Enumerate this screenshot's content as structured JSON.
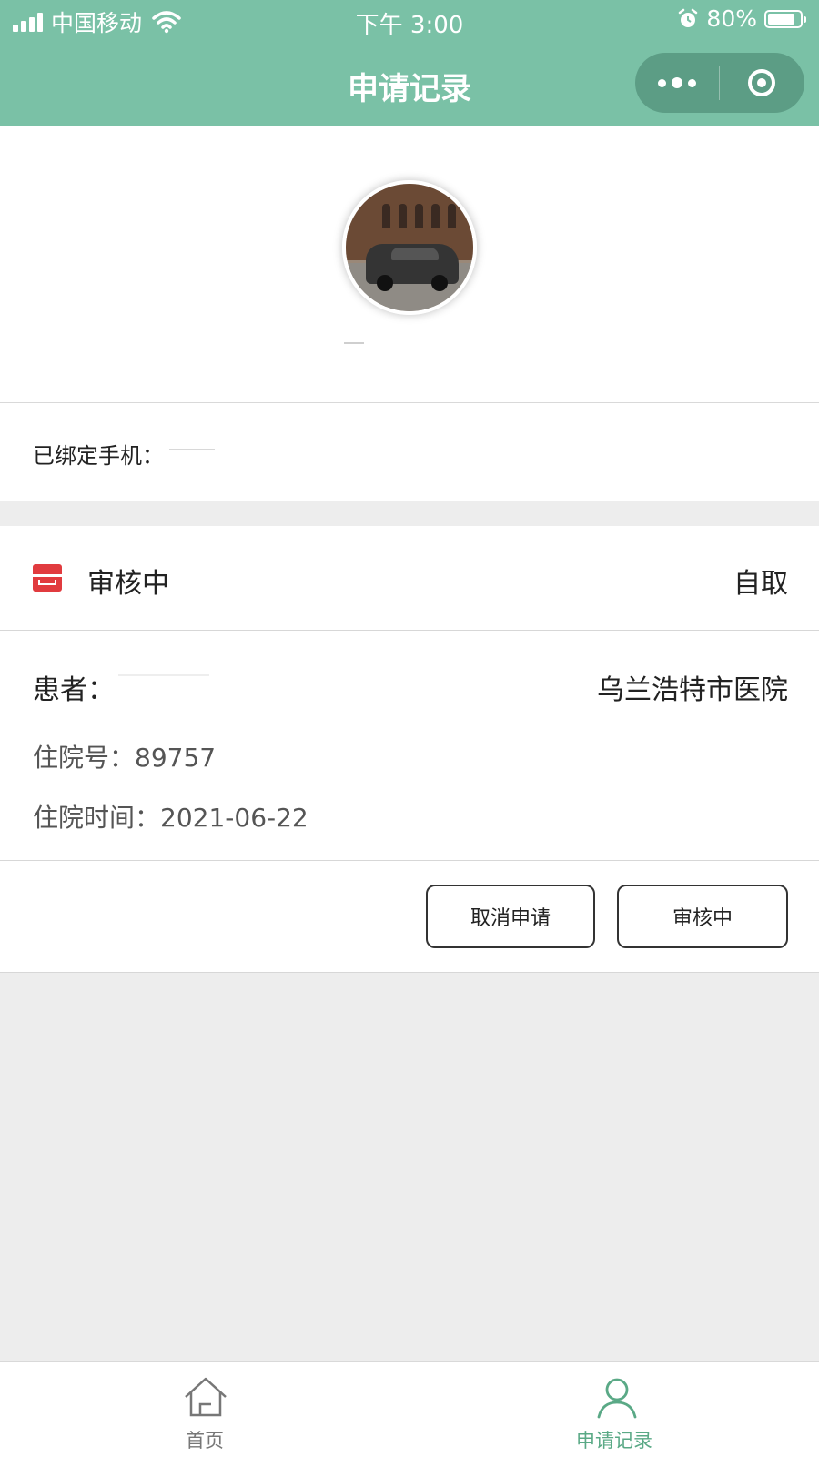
{
  "status_bar": {
    "carrier": "中国移动",
    "time": "下午 3:00",
    "battery_percent": "80%",
    "icons": [
      "signal-icon",
      "wifi-icon",
      "alarm-icon",
      "battery-icon"
    ]
  },
  "nav": {
    "title": "申请记录"
  },
  "profile": {
    "avatar_icon": "car-photo-avatar"
  },
  "phone": {
    "label": "已绑定手机："
  },
  "application": {
    "status": "审核中",
    "pickup_method": "自取",
    "patient_label": "患者：",
    "hospital": "乌兰浩特市医院",
    "admission_no_label": "住院号：",
    "admission_no": "89757",
    "admission_time_label": "住院时间：",
    "admission_time": "2021-06-22",
    "cancel_button": "取消申请",
    "status_button": "审核中"
  },
  "tabbar": {
    "home_label": "首页",
    "records_label": "申请记录"
  },
  "colors": {
    "header_green": "#7ac1a6",
    "active_tab": "#5aa986",
    "status_icon_red": "#e13b3f"
  }
}
